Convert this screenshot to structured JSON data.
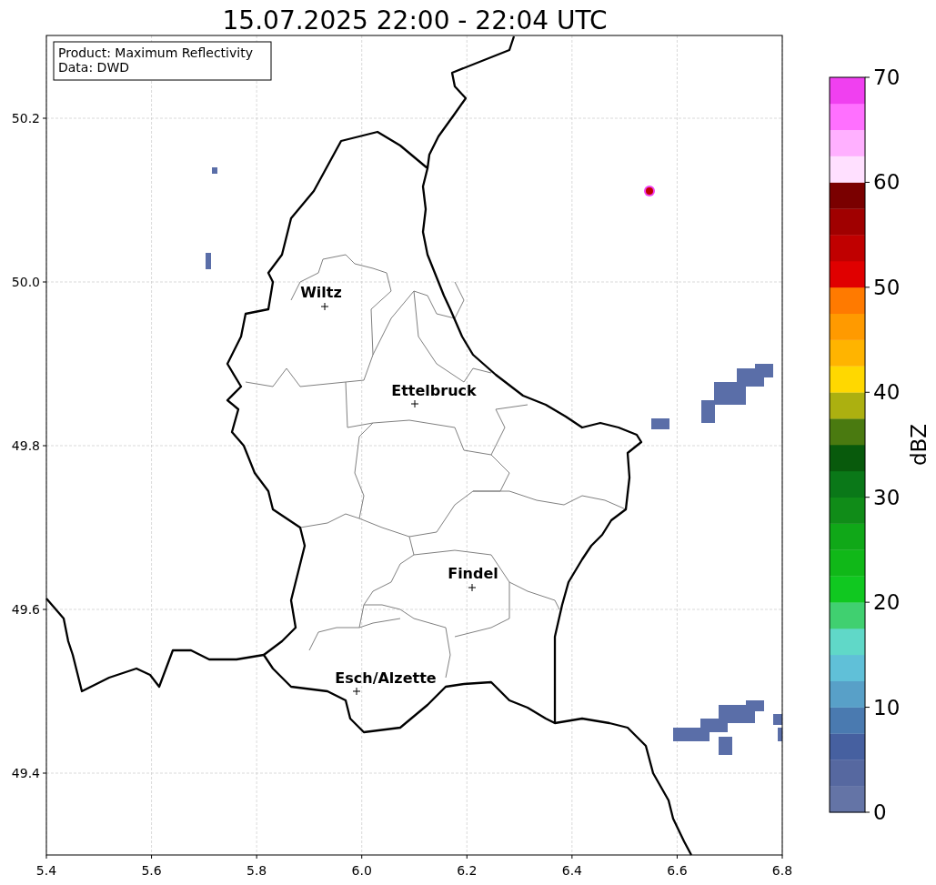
{
  "title": "15.07.2025 22:00 - 22:04 UTC",
  "info_box": [
    "Product: Maximum Reflectivity",
    "Data: DWD"
  ],
  "x_ticks": [
    "5.4",
    "5.6",
    "5.8",
    "6.0",
    "6.2",
    "6.4",
    "6.6",
    "6.8"
  ],
  "y_ticks": [
    "50.2",
    "50.0",
    "49.8",
    "49.6",
    "49.4"
  ],
  "cities": [
    {
      "name": "Wiltz"
    },
    {
      "name": "Ettelbruck"
    },
    {
      "name": "Findel"
    },
    {
      "name": "Esch/Alzette"
    }
  ],
  "colorbar": {
    "label": "dBZ",
    "ticks": [
      "70",
      "60",
      "50",
      "40",
      "30",
      "20",
      "10",
      "0"
    ],
    "segments": [
      {
        "color": "#6474a6"
      },
      {
        "color": "#5668a0"
      },
      {
        "color": "#4660a0"
      },
      {
        "color": "#4a7ab0"
      },
      {
        "color": "#58a0c8"
      },
      {
        "color": "#60c0d8"
      },
      {
        "color": "#60d8c8"
      },
      {
        "color": "#40d070"
      },
      {
        "color": "#10c820"
      },
      {
        "color": "#10b818"
      },
      {
        "color": "#10a818"
      },
      {
        "color": "#108c18"
      },
      {
        "color": "#0a7818"
      },
      {
        "color": "#085a0c"
      },
      {
        "color": "#4a7a10"
      },
      {
        "color": "#acb010"
      },
      {
        "color": "#ffd800"
      },
      {
        "color": "#ffb400"
      },
      {
        "color": "#ff9a00"
      },
      {
        "color": "#ff7a00"
      },
      {
        "color": "#e00000"
      },
      {
        "color": "#c00000"
      },
      {
        "color": "#a00000"
      },
      {
        "color": "#7a0000"
      },
      {
        "color": "#ffe0ff"
      },
      {
        "color": "#ffb0ff"
      },
      {
        "color": "#ff70ff"
      },
      {
        "color": "#f040f0"
      }
    ]
  }
}
